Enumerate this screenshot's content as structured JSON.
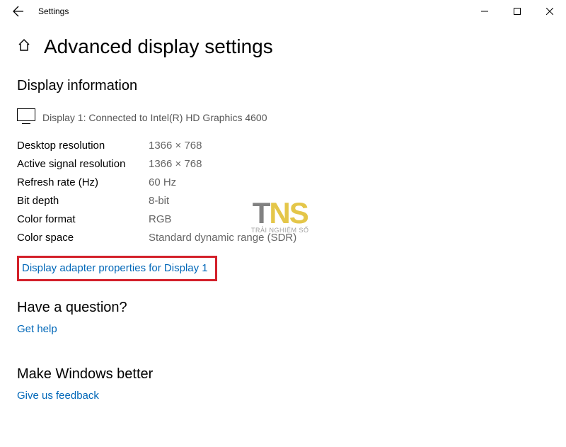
{
  "titlebar": {
    "title": "Settings"
  },
  "header": {
    "page_title": "Advanced display settings"
  },
  "display_info": {
    "heading": "Display information",
    "connected": "Display 1: Connected to Intel(R) HD Graphics 4600",
    "rows": [
      {
        "label": "Desktop resolution",
        "value": "1366 × 768"
      },
      {
        "label": "Active signal resolution",
        "value": "1366 × 768"
      },
      {
        "label": "Refresh rate (Hz)",
        "value": "60 Hz"
      },
      {
        "label": "Bit depth",
        "value": "8-bit"
      },
      {
        "label": "Color format",
        "value": "RGB"
      },
      {
        "label": "Color space",
        "value": "Standard dynamic range (SDR)"
      }
    ],
    "adapter_link": "Display adapter properties for Display 1"
  },
  "question": {
    "heading": "Have a question?",
    "link": "Get help"
  },
  "better": {
    "heading": "Make Windows better",
    "link": "Give us feedback"
  },
  "watermark": {
    "sub": "TRẢI NGHIỆM SỐ"
  }
}
